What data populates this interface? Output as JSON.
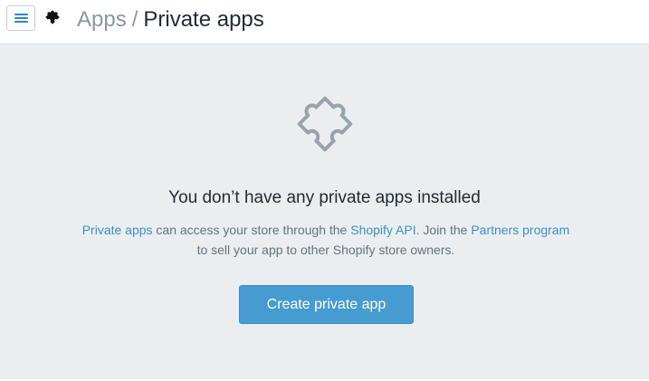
{
  "header": {
    "breadcrumb_parent": "Apps",
    "breadcrumb_separator": "/",
    "breadcrumb_current": "Private apps",
    "menu_icon": "hamburger-menu-icon",
    "section_icon": "puzzle-piece-icon"
  },
  "empty_state": {
    "icon": "puzzle-piece-outline-icon",
    "title": "You don’t have any private apps installed",
    "desc_link_private_apps": "Private apps",
    "desc_text_1": " can access your store through the ",
    "desc_link_api": "Shopify API",
    "desc_text_2": ". Join the ",
    "desc_link_partners": "Partners program",
    "desc_text_3": "to sell your app to other Shopify store owners.",
    "create_button_label": "Create private app"
  },
  "colors": {
    "accent": "#479ccf",
    "link": "#3d8fc7",
    "page_background": "#ebeef0"
  }
}
